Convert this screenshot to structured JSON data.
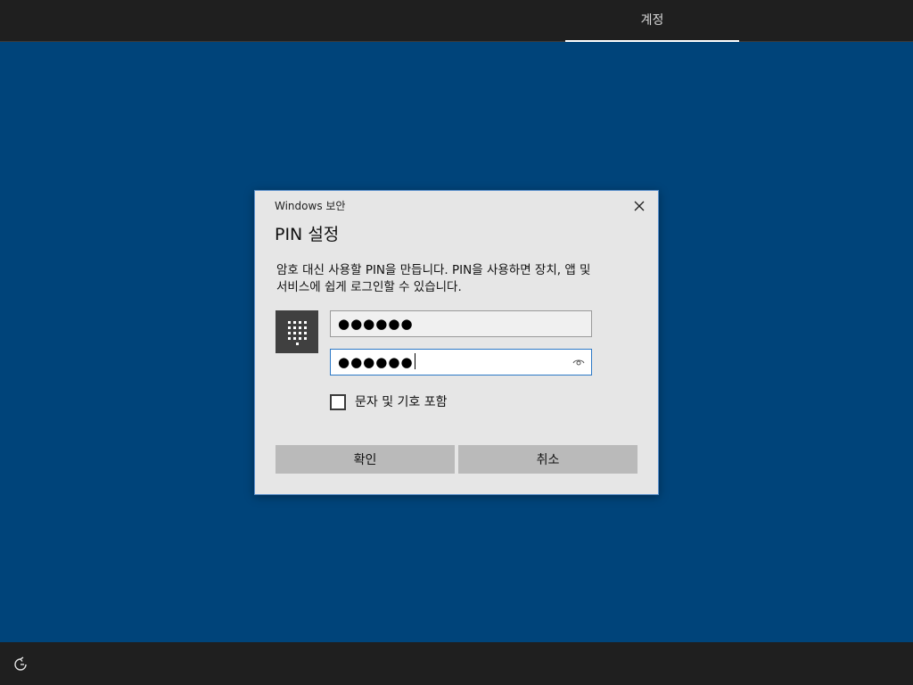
{
  "topbar": {
    "tab_label": "계정"
  },
  "dialog": {
    "app_name": "Windows 보안",
    "title": "PIN 설정",
    "description_line1": "암호 대신 사용할 PIN을 만듭니다. PIN을 사용하면 장치, 앱 및",
    "description_line2": "서비스에 쉽게 로그인할 수 있습니다.",
    "pin_value": "●●●●●●",
    "confirm_pin_value": "●●●●●●",
    "include_letters_label": "문자 및 기호 포함",
    "include_letters_checked": false,
    "ok_label": "확인",
    "cancel_label": "취소"
  },
  "colors": {
    "background": "#00447a",
    "bar": "#1f1f1f",
    "dialog": "#e6e6e6",
    "focus_border": "#2b78c6",
    "button": "#bababa"
  },
  "icons": {
    "close": "close-icon",
    "keypad": "keypad-icon",
    "reveal": "eye-icon",
    "accessibility": "ease-of-access-icon"
  }
}
